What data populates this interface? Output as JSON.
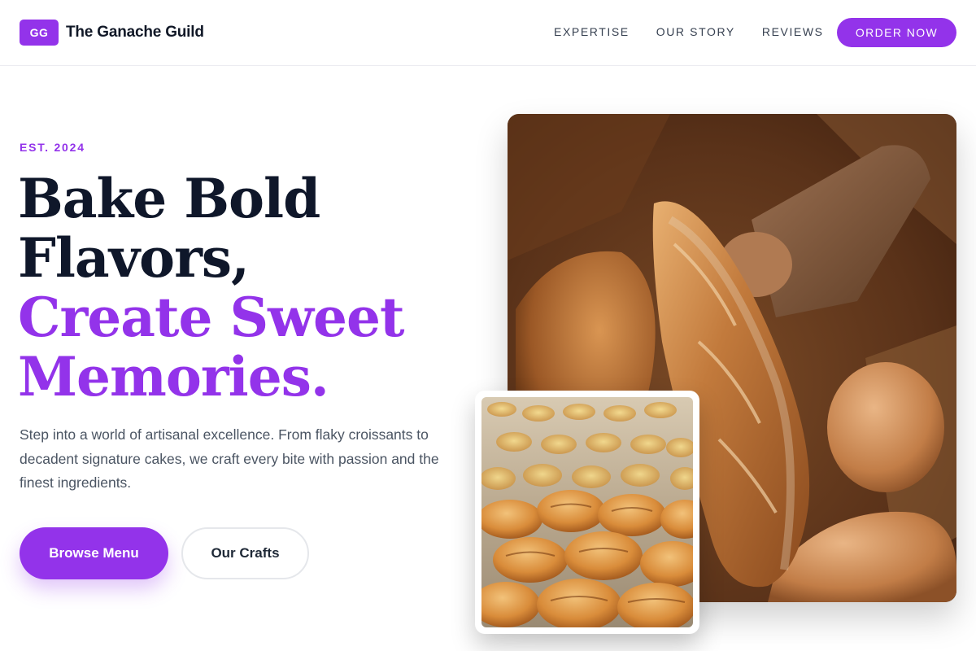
{
  "brand": {
    "logo_text": "GG",
    "name": "The Ganache Guild",
    "accent_color": "#9333ea"
  },
  "nav": {
    "links": [
      "EXPERTISE",
      "OUR STORY",
      "REVIEWS"
    ],
    "cta": "ORDER NOW"
  },
  "hero": {
    "eyebrow": "EST. 2024",
    "headline_line1": "Bake Bold",
    "headline_line2": "Flavors,",
    "headline_line3": "Create Sweet",
    "headline_line4": "Memories.",
    "description": "Step into a world of artisanal excellence. From flaky croissants to decadent signature cakes, we craft every bite with passion and the finest ingredients.",
    "primary_button": "Browse Menu",
    "secondary_button": "Our Crafts"
  },
  "images": {
    "main_photo": "rustic-bread-loaves-photo",
    "inset_photo": "pastry-tray-photo"
  }
}
